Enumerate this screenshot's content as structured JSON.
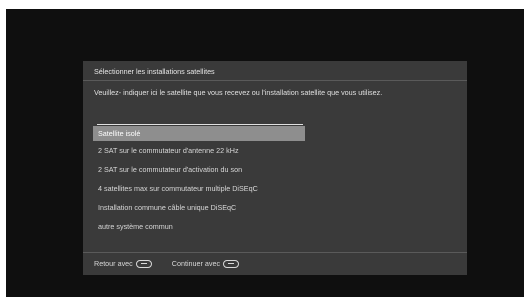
{
  "dialog": {
    "title": "Sélectionner les installations satellites",
    "instruction": "Veuillez- indiquer ici le satellite que vous recevez ou l'installation satellite que vous utilisez.",
    "options": [
      "Satellite isolé",
      "2 SAT sur le commutateur d'antenne 22 kHz",
      "2 SAT sur le commutateur d'activation du son",
      "4 satellites max sur commutateur multiple DiSEqC",
      "Installation commune câble unique DiSEqC",
      "autre système commun"
    ],
    "selected_index": 0
  },
  "footer": {
    "back_label": "Retour avec",
    "back_icon": "back-button-icon",
    "continue_label": "Continuer avec",
    "continue_icon": "ok-button-icon"
  },
  "colors": {
    "screen_bg": "#0f0f0f",
    "dialog_bg": "#3a3a3a",
    "selected_bg": "#8e8e8e"
  }
}
